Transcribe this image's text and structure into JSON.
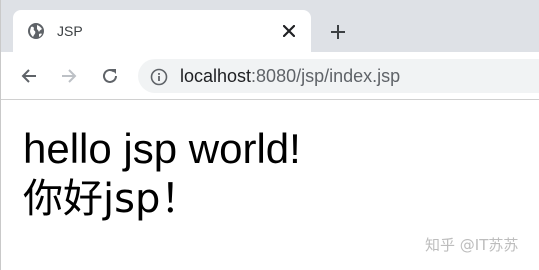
{
  "tab": {
    "title": "JSP",
    "favicon": "globe-icon",
    "close_icon": "close-icon"
  },
  "newtab": {
    "icon": "plus-icon"
  },
  "toolbar": {
    "back_icon": "back-arrow-icon",
    "forward_icon": "forward-arrow-icon",
    "reload_icon": "reload-icon",
    "site_info_icon": "info-icon"
  },
  "address": {
    "host": "localhost",
    "rest": ":8080/jsp/index.jsp"
  },
  "page": {
    "line1": "hello jsp world!",
    "line2": "你好jsp！"
  },
  "watermark": "知乎 @IT苏苏",
  "colors": {
    "tabstrip_bg": "#dee1e6",
    "omnibox_bg": "#f1f3f4",
    "icon": "#5f6368",
    "icon_disabled": "#bdc1c6"
  }
}
